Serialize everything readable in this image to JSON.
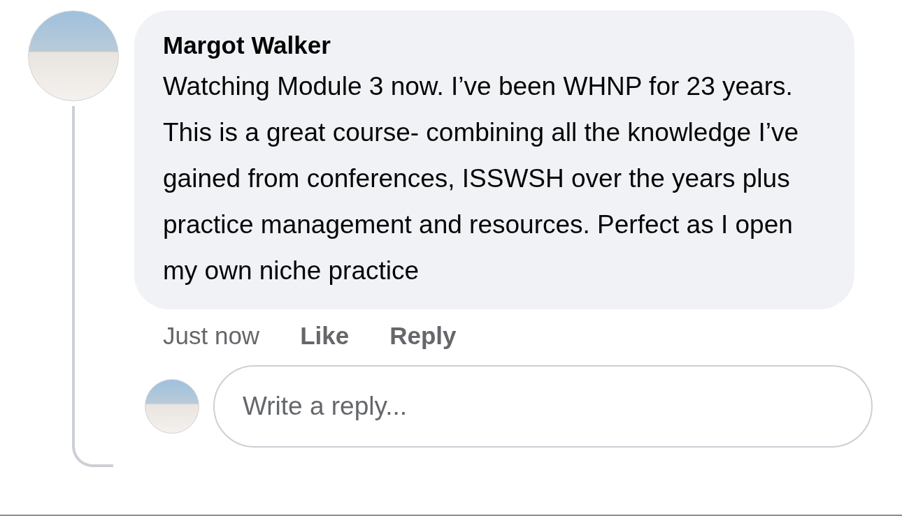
{
  "comment": {
    "author": "Margot Walker",
    "text": "Watching Module 3 now. I’ve been WHNP for 23 years. This is a great course- combining all the knowledge I’ve gained from conferences, ISSWSH over the years plus practice management and resources. Perfect as I open my own niche practice",
    "time": "Just now",
    "actions": [
      "Like",
      "Reply"
    ]
  },
  "reply_box": {
    "placeholder": "Write a reply..."
  }
}
